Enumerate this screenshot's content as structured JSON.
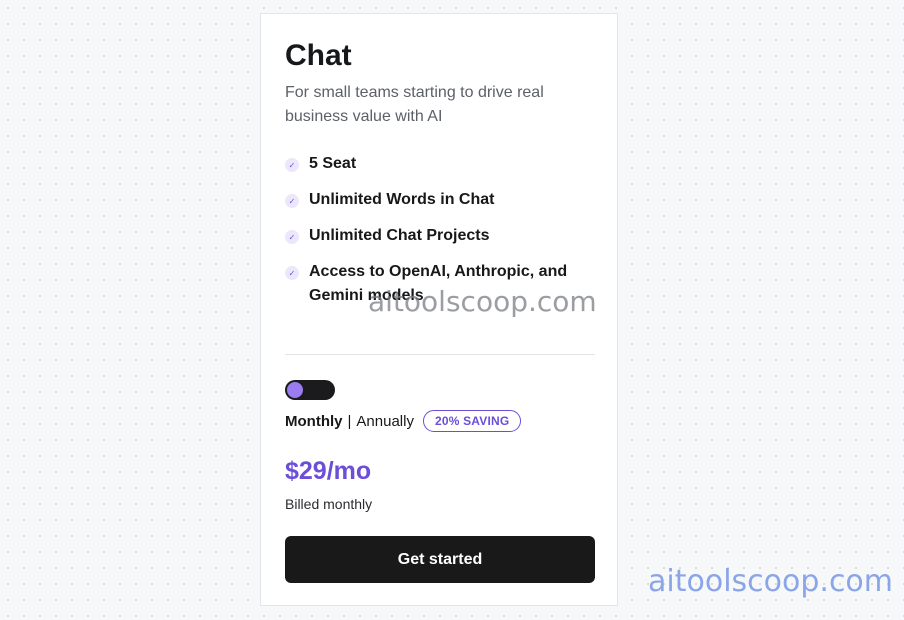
{
  "plan": {
    "title": "Chat",
    "description": "For small teams starting to drive real business value with AI",
    "features": [
      {
        "icon": "check-icon",
        "label": "5 Seat"
      },
      {
        "icon": "check-icon",
        "label": "Unlimited Words in Chat"
      },
      {
        "icon": "check-icon",
        "label": "Unlimited Chat Projects"
      },
      {
        "icon": "check-icon",
        "label": "Access to OpenAI, Anthropic, and Gemini models"
      }
    ]
  },
  "billing": {
    "toggle_state": "monthly",
    "monthly_label": "Monthly",
    "separator": "|",
    "annually_label": "Annually",
    "saving_badge": "20% SAVING"
  },
  "pricing": {
    "price": "$29/mo",
    "billed_note": "Billed monthly"
  },
  "cta": {
    "label": "Get started"
  },
  "watermarks": {
    "center": "aitoolscoop.com",
    "corner": "aitoolscoop.com"
  },
  "colors": {
    "accent": "#6b4fd8",
    "toggle_knob": "#9b7cf0",
    "button_bg": "#19191a",
    "text": "#17181a"
  }
}
